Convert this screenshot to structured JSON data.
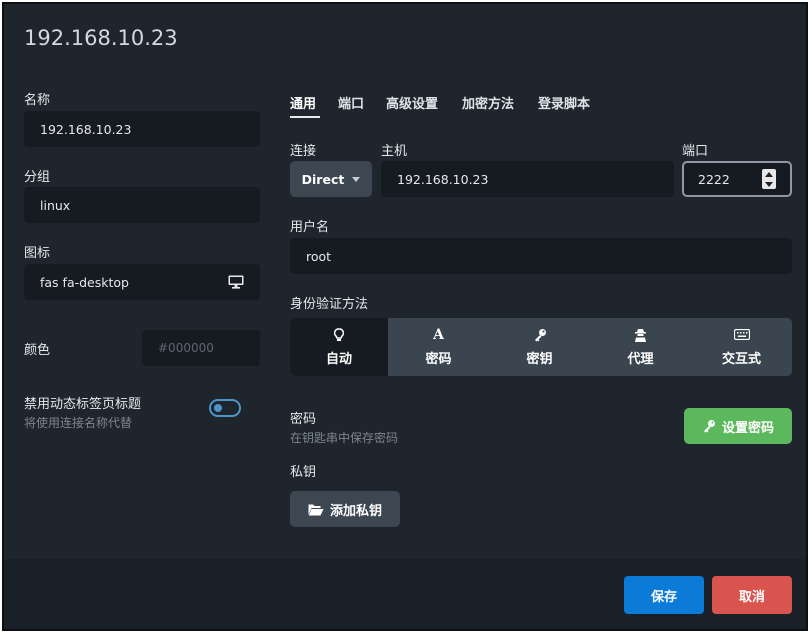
{
  "title": "192.168.10.23",
  "left": {
    "name_label": "名称",
    "name_value": "192.168.10.23",
    "group_label": "分组",
    "group_value": "linux",
    "icon_label": "图标",
    "icon_value": "fas fa-desktop",
    "color_label": "颜色",
    "color_placeholder": "#000000",
    "disable_title_label": "禁用动态标签页标题",
    "disable_title_sub": "将使用连接名称代替",
    "disable_title_on": false
  },
  "tabs": [
    {
      "label": "通用",
      "active": true
    },
    {
      "label": "端口"
    },
    {
      "label": "高级设置"
    },
    {
      "label": "加密方法"
    },
    {
      "label": "登录脚本"
    }
  ],
  "connection": {
    "conn_label": "连接",
    "conn_value": "Direct",
    "host_label": "主机",
    "host_value": "192.168.10.23",
    "port_label": "端口",
    "port_value": "2222"
  },
  "username": {
    "label": "用户名",
    "value": "root"
  },
  "auth": {
    "label": "身份验证方法",
    "options": [
      {
        "label": "自动",
        "icon": "lightbulb-icon",
        "active": true
      },
      {
        "label": "密码",
        "icon": "font-a-icon"
      },
      {
        "label": "密钥",
        "icon": "key-icon"
      },
      {
        "label": "代理",
        "icon": "user-secret-icon"
      },
      {
        "label": "交互式",
        "icon": "keyboard-icon"
      }
    ]
  },
  "password": {
    "label": "密码",
    "sub": "在钥匙串中保存密码",
    "button": "设置密码"
  },
  "private_key": {
    "label": "私钥",
    "button": "添加私钥"
  },
  "footer": {
    "save": "保存",
    "cancel": "取消"
  },
  "colors": {
    "bg": "#1f252d",
    "input_bg": "#161b21",
    "save": "#0c7bd8",
    "cancel": "#d9534f",
    "green": "#5cb85c",
    "toggle": "#4b95c9"
  }
}
